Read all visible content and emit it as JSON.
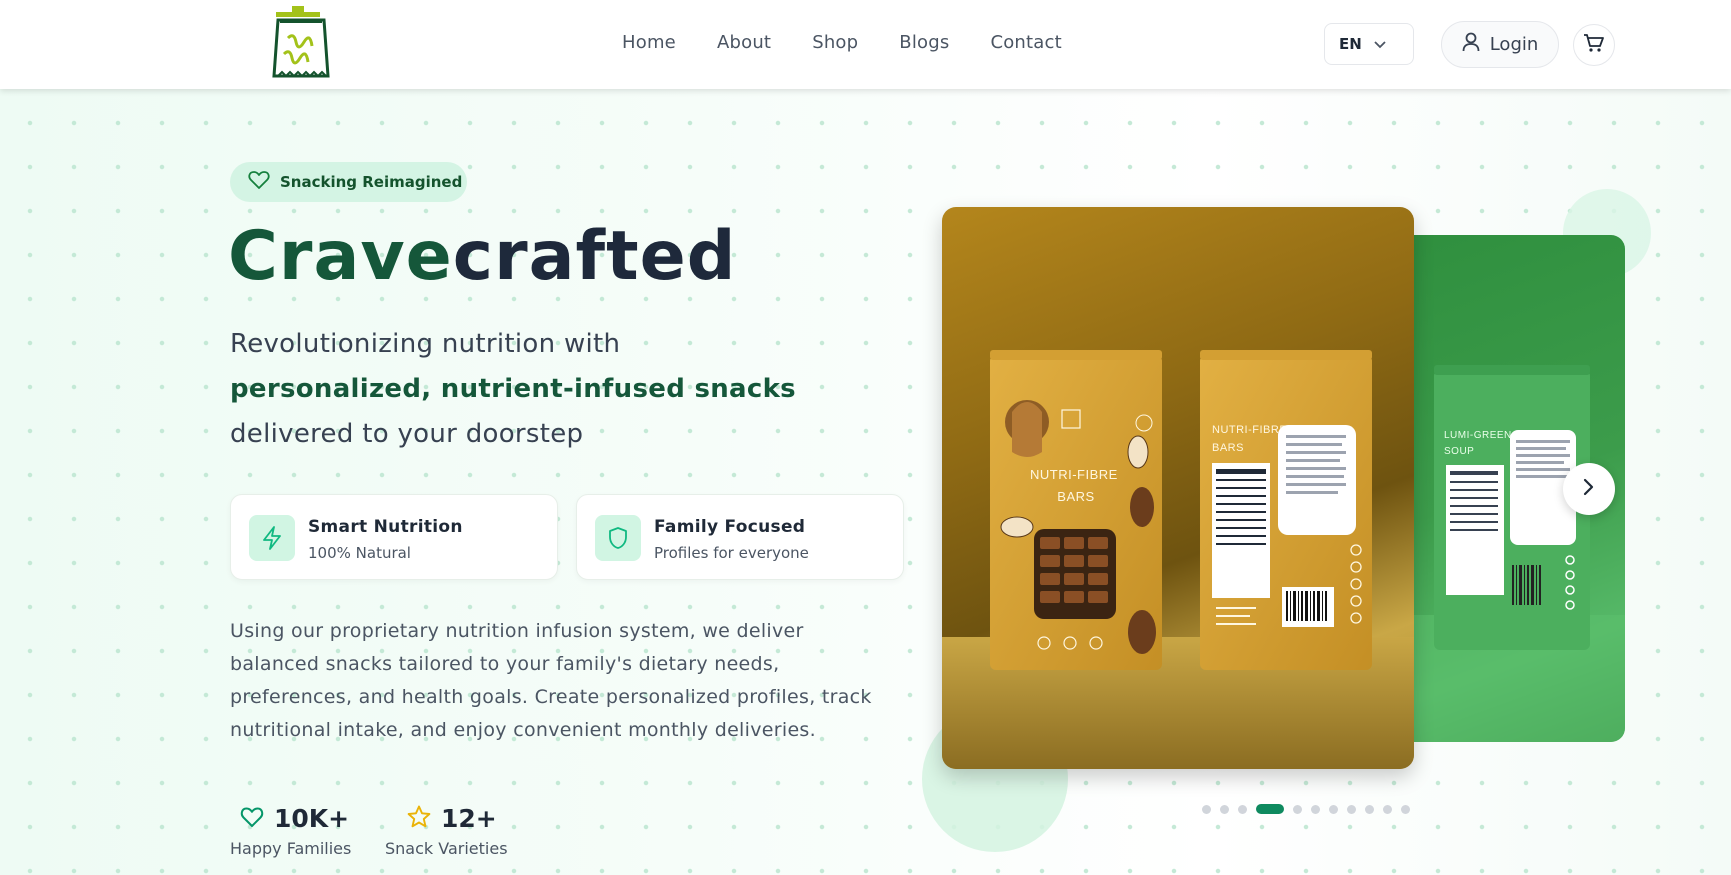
{
  "header": {
    "logo_icon": "snack-bag-logo-icon",
    "nav": [
      "Home",
      "About",
      "Shop",
      "Blogs",
      "Contact"
    ],
    "language": "EN",
    "login_label": "Login",
    "cart_icon": "cart-icon"
  },
  "hero": {
    "badge": "Snacking Reimagined",
    "title_part1": "Crave",
    "title_part2": "crafted",
    "lead_before": "Revolutionizing nutrition with ",
    "lead_bold": "personalized, nutrient-infused snacks",
    "lead_after": " delivered to your doorstep",
    "features": [
      {
        "title": "Smart Nutrition",
        "subtitle": "100% Natural",
        "icon": "lightning-icon"
      },
      {
        "title": "Family Focused",
        "subtitle": "Profiles for everyone",
        "icon": "shield-icon"
      }
    ],
    "description": "Using our proprietary nutrition infusion system, we deliver balanced snacks tailored to your family's dietary needs, preferences, and health goals. Create personalized profiles, track nutritional intake, and enjoy convenient monthly deliveries.",
    "stats": [
      {
        "value": "10K+",
        "label": "Happy Families",
        "icon": "heart-icon"
      },
      {
        "value": "12+",
        "label": "Snack Varieties",
        "icon": "star-icon"
      }
    ]
  },
  "carousel": {
    "current_slide": {
      "package_name_line1": "NUTRI-FIBRE",
      "package_name_line2": "BARS"
    },
    "next_slide": {
      "package_name_line1": "LUMI-GREEN",
      "package_name_line2": "SOUP"
    },
    "dot_count": 11,
    "active_dot": 3
  },
  "colors": {
    "brand_green": "#15573a",
    "accent": "#0f8a5f",
    "badge_bg": "#d4f4e4"
  }
}
